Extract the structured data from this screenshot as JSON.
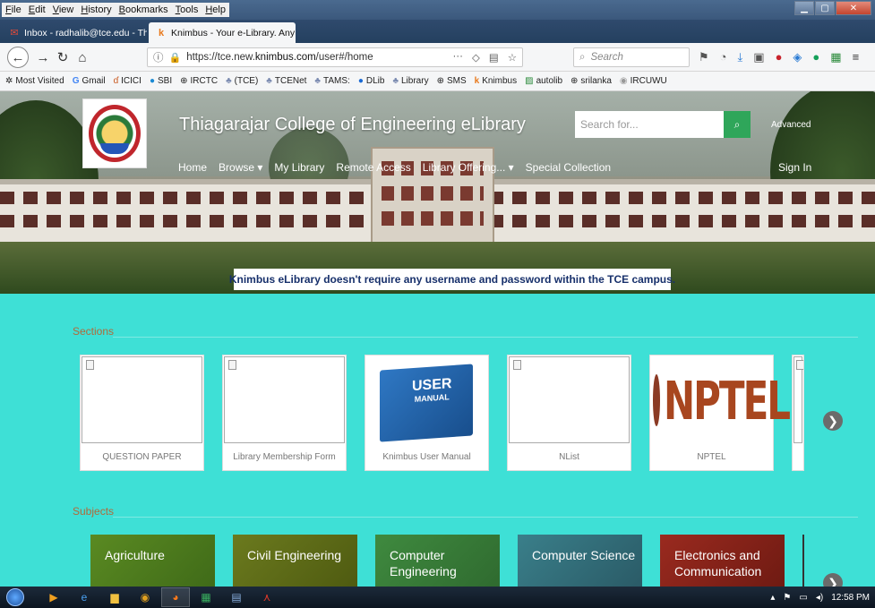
{
  "menubar": {
    "items": [
      "File",
      "Edit",
      "View",
      "History",
      "Bookmarks",
      "Tools",
      "Help"
    ]
  },
  "tabs": [
    {
      "label": "Inbox - radhalib@tce.edu - Thi",
      "close": "X"
    },
    {
      "label": "Knimbus - Your e-Library. Any",
      "close": "X"
    }
  ],
  "newtab": "+",
  "nav": {
    "url_prefix": "https://tce.new.",
    "url_domain": "knimbus.com",
    "url_path": "/user#/home",
    "search_placeholder": "Search"
  },
  "bookmarks": [
    "Most Visited",
    "Gmail",
    "ICICI",
    "SBI",
    "IRCTC",
    "(TCE)",
    "TCENet",
    "TAMS:",
    "DLib",
    "Library",
    "SMS",
    "Knimbus",
    "autolib",
    "srilanka",
    "IRCUWU"
  ],
  "site": {
    "title": "Thiagarajar College of Engineering eLibrary",
    "search_placeholder": "Search for...",
    "advanced": "Advanced",
    "nav": [
      "Home",
      "Browse",
      "My Library",
      "Remote Access",
      "Library Offering...",
      "Special Collection"
    ],
    "signin": "Sign In",
    "notice": "Knimbus eLibrary doesn't require any username and password within the TCE campus."
  },
  "sections": {
    "heading": "Sections",
    "cards": [
      "QUESTION PAPER",
      "Library Membership Form",
      "Knimbus User Manual",
      "NList",
      "NPTEL"
    ],
    "manual_text": "USER",
    "manual_sub": "MANUAL",
    "nptel_text": "NPTEL"
  },
  "subjects": {
    "heading": "Subjects",
    "items": [
      "Agriculture",
      "Civil Engineering",
      "Computer Engineering",
      "Computer Science",
      "Electronics and Communication"
    ]
  },
  "taskbar": {
    "time": "12:58 PM"
  }
}
